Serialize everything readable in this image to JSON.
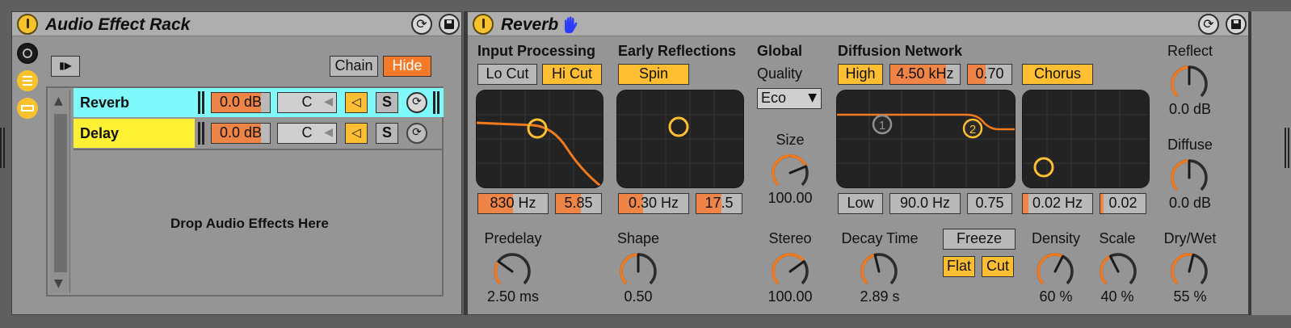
{
  "rack": {
    "title": "Audio Effect Rack",
    "chain_button": "Chain",
    "hide_button": "Hide",
    "drop_hint": "Drop Audio Effects Here",
    "chains": [
      {
        "name": "Reverb",
        "volume": "0.0 dB",
        "pan": "C",
        "solo": "S",
        "color": "#7ff9fa",
        "volume_fill": 0.85
      },
      {
        "name": "Delay",
        "volume": "0.0 dB",
        "pan": "C",
        "solo": "S",
        "color": "#fef033",
        "volume_fill": 0.85
      }
    ]
  },
  "reverb": {
    "title": "Reverb",
    "input": {
      "heading": "Input Processing",
      "locut": "Lo Cut",
      "hicut": "Hi Cut",
      "freq": "830 Hz",
      "q": "5.85"
    },
    "early": {
      "heading": "Early Reflections",
      "spin": "Spin",
      "rate": "0.30 Hz",
      "amount": "17.5"
    },
    "global": {
      "heading": "Global",
      "quality_label": "Quality",
      "quality_value": "Eco",
      "size_label": "Size",
      "size_value": "100.00",
      "stereo_label": "Stereo",
      "stereo_value": "100.00"
    },
    "diffusion": {
      "heading": "Diffusion Network",
      "high": "High",
      "high_freq": "4.50 kHz",
      "high_amt": "0.70",
      "chorus": "Chorus",
      "low": "Low",
      "low_freq": "90.0 Hz",
      "low_amt": "0.75",
      "chorus_rate": "0.02 Hz",
      "chorus_amt": "0.02",
      "node1": "1",
      "node2": "2"
    },
    "predelay": {
      "label": "Predelay",
      "value": "2.50 ms",
      "level": 0.3
    },
    "shape": {
      "label": "Shape",
      "value": "0.50",
      "level": 0.5
    },
    "decay": {
      "label": "Decay Time",
      "value": "2.89 s",
      "level": 0.45
    },
    "freeze": "Freeze",
    "flat": "Flat",
    "cut": "Cut",
    "density": {
      "label": "Density",
      "value": "60 %",
      "level": 0.6
    },
    "scale": {
      "label": "Scale",
      "value": "40 %",
      "level": 0.4
    },
    "reflect": {
      "label": "Reflect",
      "value": "0.0 dB",
      "level": 0.5
    },
    "diffuse": {
      "label": "Diffuse",
      "value": "0.0 dB",
      "level": 0.5
    },
    "drywet": {
      "label": "Dry/Wet",
      "value": "55 %",
      "level": 0.55
    },
    "size_level": 0.75,
    "stereo_level": 0.7
  },
  "colors": {
    "accent_orange": "#f47a2a",
    "toggle_yellow": "#fdbe32",
    "chain_reverb": "#7ff9fa",
    "chain_delay": "#fef033",
    "display_bg": "#232323"
  }
}
